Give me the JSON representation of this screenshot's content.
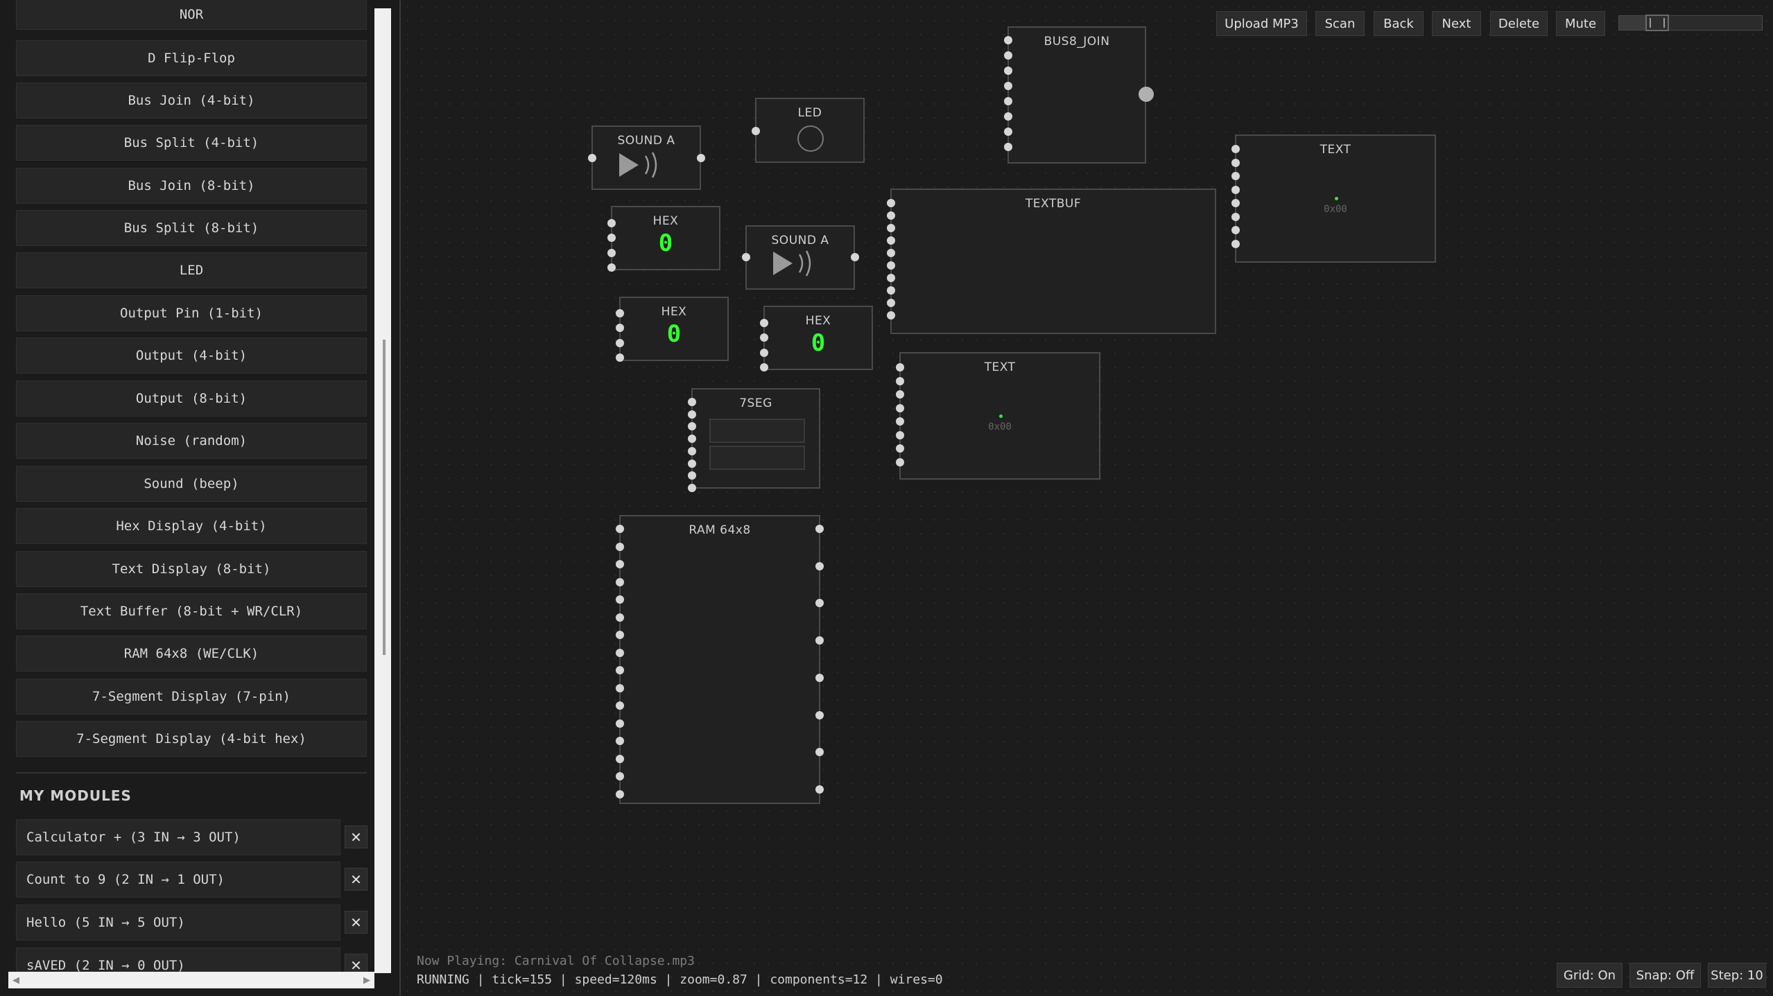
{
  "library": {
    "items": [
      "NOR",
      "D Flip-Flop",
      "Bus Join (4-bit)",
      "Bus Split (4-bit)",
      "Bus Join (8-bit)",
      "Bus Split (8-bit)",
      "LED",
      "Output Pin (1-bit)",
      "Output (4-bit)",
      "Output (8-bit)",
      "Noise (random)",
      "Sound (beep)",
      "Hex Display (4-bit)",
      "Text Display (8-bit)",
      "Text Buffer (8-bit + WR/CLR)",
      "RAM 64x8 (WE/CLK)",
      "7-Segment Display (7-pin)",
      "7-Segment Display (4-bit hex)"
    ]
  },
  "my_modules": {
    "title": "MY MODULES",
    "delete_glyph": "✕",
    "items": [
      "Calculator + (3 IN → 3 OUT)",
      "Count to 9 (2 IN → 1 OUT)",
      "Hello (5 IN → 5 OUT)",
      "sAVED (2 IN → 0 OUT)"
    ]
  },
  "toolbar": {
    "upload": "Upload MP3",
    "scan": "Scan",
    "back": "Back",
    "next": "Next",
    "delete": "Delete",
    "mute": "Mute",
    "volume_level": 0.22
  },
  "components": {
    "bus8_join": "BUS8_JOIN",
    "led": "LED",
    "sound_a_1": "SOUND A",
    "sound_a_2": "SOUND A",
    "hex_1": "HEX",
    "hex_1_value": "0",
    "hex_2": "HEX",
    "hex_2_value": "0",
    "hex_3": "HEX",
    "hex_3_value": "0",
    "textbuf": "TEXTBUF",
    "text_1": "TEXT",
    "text_1_value": "0x00",
    "text_2": "TEXT",
    "text_2_value": "0x00",
    "seg7": "7SEG",
    "ram": "RAM 64x8"
  },
  "status": {
    "now_playing": "Now Playing: Carnival Of Collapse.mp3",
    "line": "RUNNING | tick=155 | speed=120ms | zoom=0.87 | components=12 | wires=0"
  },
  "bottom_toolbar": {
    "grid": "Grid: On",
    "snap": "Snap: Off",
    "step": "Step: 10"
  },
  "icons": {
    "play": "play-icon",
    "speaker_waves": "sound-waves-icon"
  }
}
